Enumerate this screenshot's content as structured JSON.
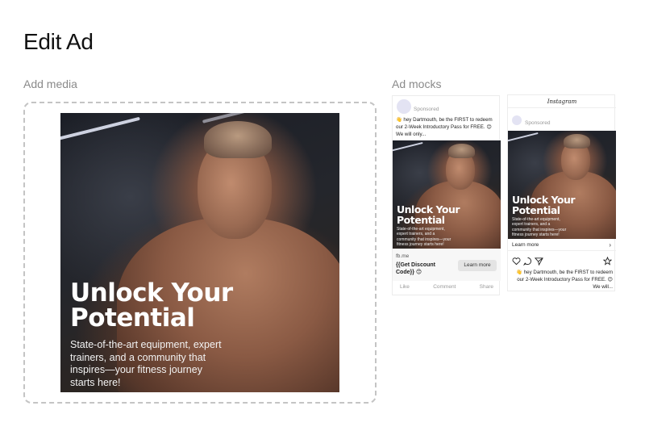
{
  "page": {
    "title": "Edit Ad"
  },
  "sections": {
    "media_label": "Add media",
    "mocks_label": "Ad mocks"
  },
  "creative": {
    "headline": "Unlock Your Potential",
    "subtext": "State-of-the-art equipment, expert trainers, and a community that inspires—your fitness journey starts here!"
  },
  "facebook_mock": {
    "sponsored": "Sponsored",
    "body": "👋 hey Dartmouth, be the FIRST to redeem our 2-Week Introductory Pass for FREE. 😊 We will only...",
    "domain": "fb.me",
    "cta_title": "{{Get Discount Code}} 😊",
    "learn_more": "Learn more",
    "actions": [
      "Like",
      "Comment",
      "Share"
    ]
  },
  "instagram_mock": {
    "app_name": "Instagram",
    "sponsored": "Sponsored",
    "learn_more": "Learn more",
    "chevron": "›",
    "caption": "👋 hey Dartmouth, be the FIRST to redeem our 2-Week Introductory Pass for FREE. 😊 We will..."
  },
  "icons": {
    "instagram_actions": [
      "heart-icon",
      "comment-icon",
      "share-icon",
      "bookmark-icon"
    ]
  }
}
